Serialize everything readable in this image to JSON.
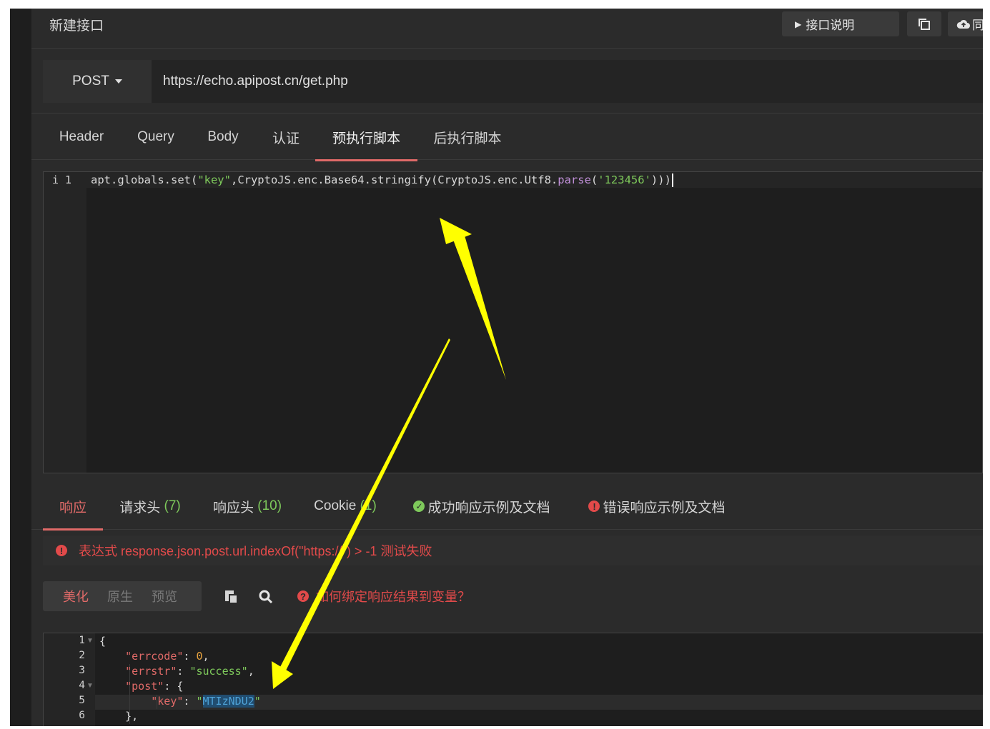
{
  "header": {
    "title": "新建接口",
    "doc_button": "接口说明",
    "sync_button": "同"
  },
  "request": {
    "method": "POST",
    "url": "https://echo.apipost.cn/get.php"
  },
  "request_tabs": [
    "Header",
    "Query",
    "Body",
    "认证",
    "预执行脚本",
    "后执行脚本"
  ],
  "active_request_tab": "预执行脚本",
  "script_editor": {
    "line_info": "i 1",
    "code": {
      "p1": "apt.globals.set(",
      "s1": "\"key\"",
      "p2": ",CryptoJS.enc.Base64.stringify(CryptoJS.enc.Utf8.",
      "fn": "parse",
      "p3": "(",
      "s2": "'123456'",
      "p4": ")))"
    }
  },
  "response_tabs": {
    "response": "响应",
    "req_headers": "请求头",
    "req_headers_count": "(7)",
    "resp_headers": "响应头",
    "resp_headers_count": "(10)",
    "cookie": "Cookie",
    "cookie_count": "(1)",
    "success_doc": "成功响应示例及文档",
    "error_doc": "错误响应示例及文档"
  },
  "error_message": "表达式 response.json.post.url.indexOf(\"https://\") > -1 测试失败",
  "view_modes": [
    "美化",
    "原生",
    "预览"
  ],
  "active_view_mode": "美化",
  "bind_link": "如何绑定响应结果到变量？",
  "response_body": {
    "line_numbers": [
      "1",
      "2",
      "3",
      "4",
      "5",
      "6"
    ],
    "open_brace": "{",
    "errcode_key": "\"errcode\"",
    "errcode_val": "0",
    "errstr_key": "\"errstr\"",
    "errstr_val": "\"success\"",
    "post_key": "\"post\"",
    "key_key": "\"key\"",
    "key_val": "MTIzNDU2",
    "close_brace": "},"
  },
  "colors": {
    "accent": "#e06a68",
    "error": "#e24a4a",
    "success": "#7ec95b",
    "arrow": "#ffff00"
  }
}
